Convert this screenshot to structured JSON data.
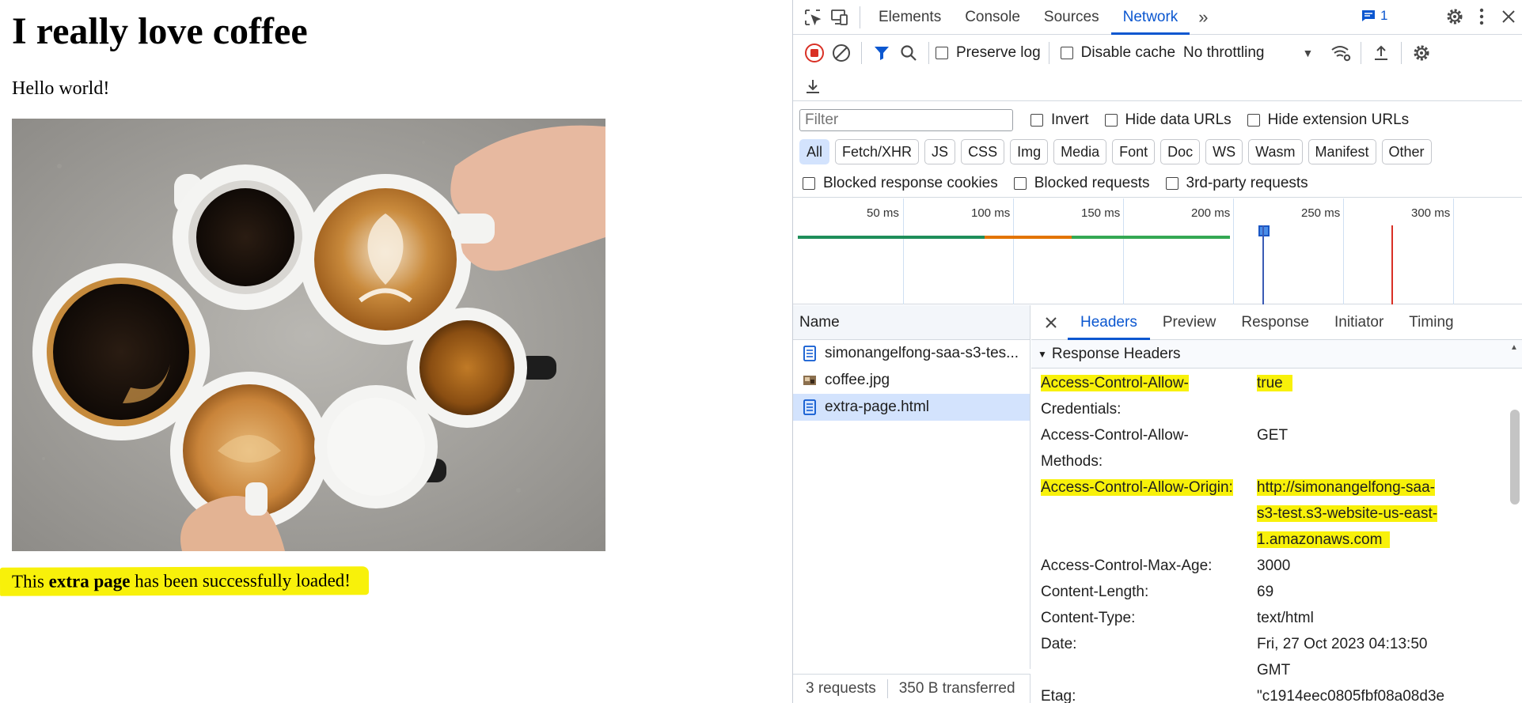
{
  "page": {
    "heading": "I really love coffee",
    "paragraph": "Hello world!",
    "success_pre": "This ",
    "success_bold": "extra page",
    "success_post": " has been successfully loaded!"
  },
  "devtools": {
    "tabs": [
      "Elements",
      "Console",
      "Sources",
      "Network"
    ],
    "active_tab": "Network",
    "messages_count": "1",
    "toolbar": {
      "preserve_log": "Preserve log",
      "disable_cache": "Disable cache",
      "throttling": "No throttling"
    },
    "filter": {
      "placeholder": "Filter",
      "invert": "Invert",
      "hide_data_urls": "Hide data URLs",
      "hide_extension_urls": "Hide extension URLs"
    },
    "types": [
      "All",
      "Fetch/XHR",
      "JS",
      "CSS",
      "Img",
      "Media",
      "Font",
      "Doc",
      "WS",
      "Wasm",
      "Manifest",
      "Other"
    ],
    "blocked": {
      "cookies": "Blocked response cookies",
      "requests": "Blocked requests",
      "third_party": "3rd-party requests"
    },
    "timeline_labels": [
      "50 ms",
      "100 ms",
      "150 ms",
      "200 ms",
      "250 ms",
      "300 ms"
    ],
    "name_header": "Name",
    "requests": [
      {
        "name": "simonangelfong-saa-s3-tes...",
        "type": "doc"
      },
      {
        "name": "coffee.jpg",
        "type": "img"
      },
      {
        "name": "extra-page.html",
        "type": "doc"
      }
    ],
    "status": {
      "requests": "3 requests",
      "transferred": "350 B transferred"
    },
    "detail_tabs": [
      "Headers",
      "Preview",
      "Response",
      "Initiator",
      "Timing"
    ],
    "section_title": "Response Headers",
    "headers": [
      {
        "key1": "Access-Control-Allow-",
        "key2": "Credentials:",
        "value1": "true",
        "value2": ""
      },
      {
        "key1": "Access-Control-Allow-",
        "key2": "Methods:",
        "value1": "GET",
        "value2": ""
      },
      {
        "key1": "Access-Control-Allow-Origin:",
        "value1": "http://simonangelfong-saa-",
        "value2": "s3-test.s3-website-us-east-",
        "value3": "1.amazonaws.com"
      },
      {
        "key1": "Access-Control-Max-Age:",
        "value1": "3000"
      },
      {
        "key1": "Content-Length:",
        "value1": "69"
      },
      {
        "key1": "Content-Type:",
        "value1": "text/html"
      },
      {
        "key1": "Date:",
        "value1": "Fri, 27 Oct 2023 04:13:50",
        "value2": "GMT"
      },
      {
        "key1": "Etag:",
        "value1": "\"c1914eec0805fbf08a08d3e"
      }
    ],
    "colors": {
      "accent": "#0b57d0",
      "highlight": "#f8f10a",
      "record": "#d93025"
    }
  }
}
